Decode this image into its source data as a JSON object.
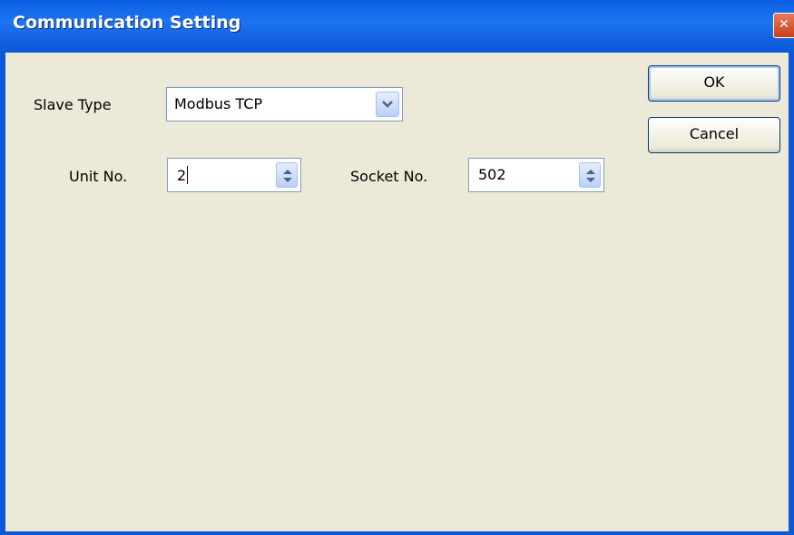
{
  "window": {
    "title": "Communication Setting",
    "close_glyph": "✕"
  },
  "form": {
    "slave_type_label": "Slave Type",
    "slave_type_value": "Modbus TCP",
    "unit_no_label": "Unit No.",
    "unit_no_value": "2",
    "socket_no_label": "Socket No.",
    "socket_no_value": "502"
  },
  "buttons": {
    "ok_label": "OK",
    "cancel_label": "Cancel"
  },
  "icons": {
    "combo_arrow": "chevron-down-icon",
    "spinner": "spin-up-down-icon",
    "close": "close-icon"
  },
  "colors": {
    "titlebar": "#0a5fe0",
    "dialog_bg": "#ece9d8",
    "close_red": "#c7401c",
    "control_border": "#7f9db9"
  }
}
